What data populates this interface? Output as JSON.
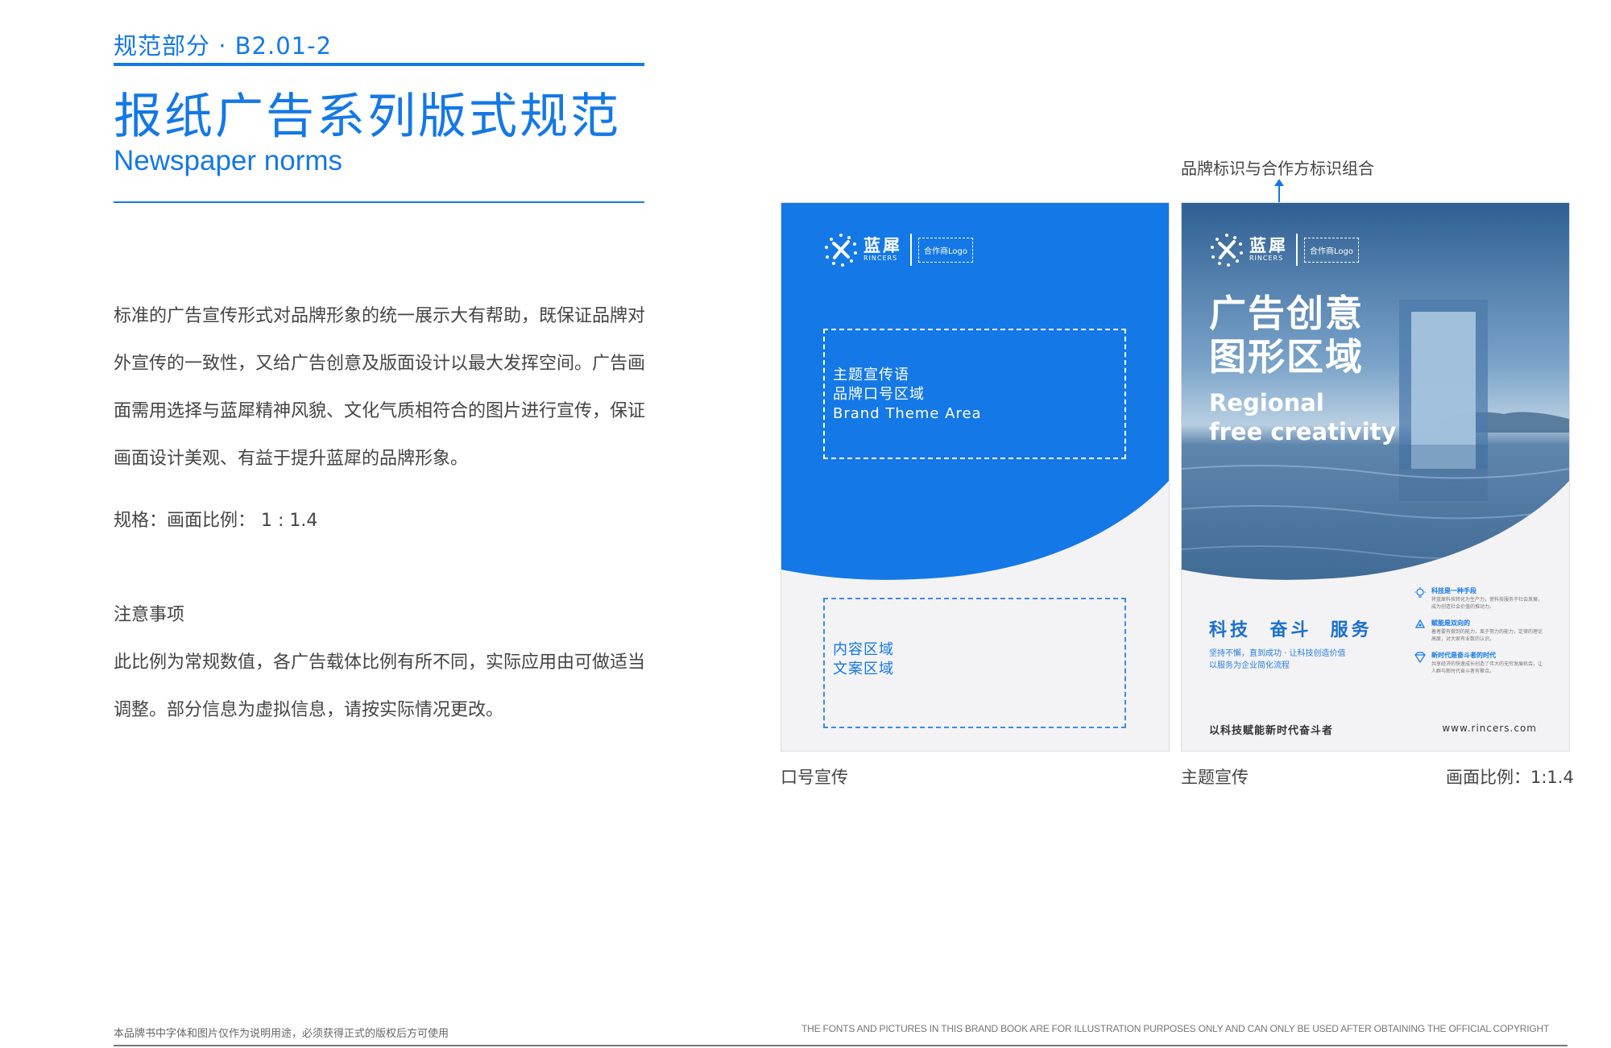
{
  "header": {
    "section_label": "规范部分 · B2.01-2",
    "title": "报纸广告系列版式规范",
    "subtitle": "Newspaper norms"
  },
  "body": {
    "intro": "标准的广告宣传形式对品牌形象的统一展示大有帮助，既保证品牌对外宣传的一致性，又给广告创意及版面设计以最大发挥空间。广告画面需用选择与蓝犀精神风貌、文化气质相符合的图片进行宣传，保证画面设计美观、有益于提升蓝犀的品牌形象。",
    "spec": "规格：画面比例： 1 : 1.4",
    "notes_title": "注意事项",
    "notes": "此比例为常规数值，各广告载体比例有所不同，实际应用由可做适当调整。部分信息为虚拟信息，请按实际情况更改。"
  },
  "logo": {
    "cn": "蓝犀",
    "en": "RINCERS",
    "partner": "合作商Logo"
  },
  "poster_a": {
    "theme_lines": [
      "主题宣传语",
      "品牌口号区域",
      "Brand Theme Area"
    ],
    "content_lines": [
      "内容区域",
      "文案区域"
    ],
    "caption": "口号宣传"
  },
  "poster_b": {
    "headline_cn": [
      "广告创意",
      "图形区域"
    ],
    "headline_en": [
      "Regional",
      "free creativity"
    ],
    "slogan": "科技  奋斗  服务",
    "desc": [
      "坚持不懈，直到成功 · 让科技创造价值",
      "以服务为企业简化流程"
    ],
    "features": [
      {
        "icon": "lightbulb-icon",
        "title": "科技是一种手段",
        "text": "将蓝犀科技转化为生产力，使科技服务于社会发展，成为创造社会价值的推动力。"
      },
      {
        "icon": "recycle-icon",
        "title": "赋能是双向的",
        "text": "着者要有做到的能力，离于努力的能力，定律的理论高度，对大家有业数的认识。"
      },
      {
        "icon": "diamond-icon",
        "title": "新时代是奋斗者的时代",
        "text": "共享经济的快速成长创造了伟大的无穷发展机会，让人群与新时代奋斗者有聚合。"
      }
    ],
    "tagline": "以科技赋能新时代奋斗者",
    "url": "www.rincers.com",
    "caption": "主题宣传"
  },
  "annotation": "品牌标识与合作方标识组合",
  "caption_ratio": "画面比例：1:1.4",
  "footer": {
    "left": "本品牌书中字体和图片仅作为说明用途，必须获得正式的版权后方可使用",
    "right": "THE FONTS AND PICTURES IN THIS BRAND BOOK ARE FOR ILLUSTRATION PURPOSES ONLY AND CAN ONLY BE USED AFTER OBTAINING THE OFFICIAL COPYRIGHT"
  },
  "colors": {
    "brand_blue": "#1478e6",
    "panel_gray": "#f3f3f5"
  }
}
